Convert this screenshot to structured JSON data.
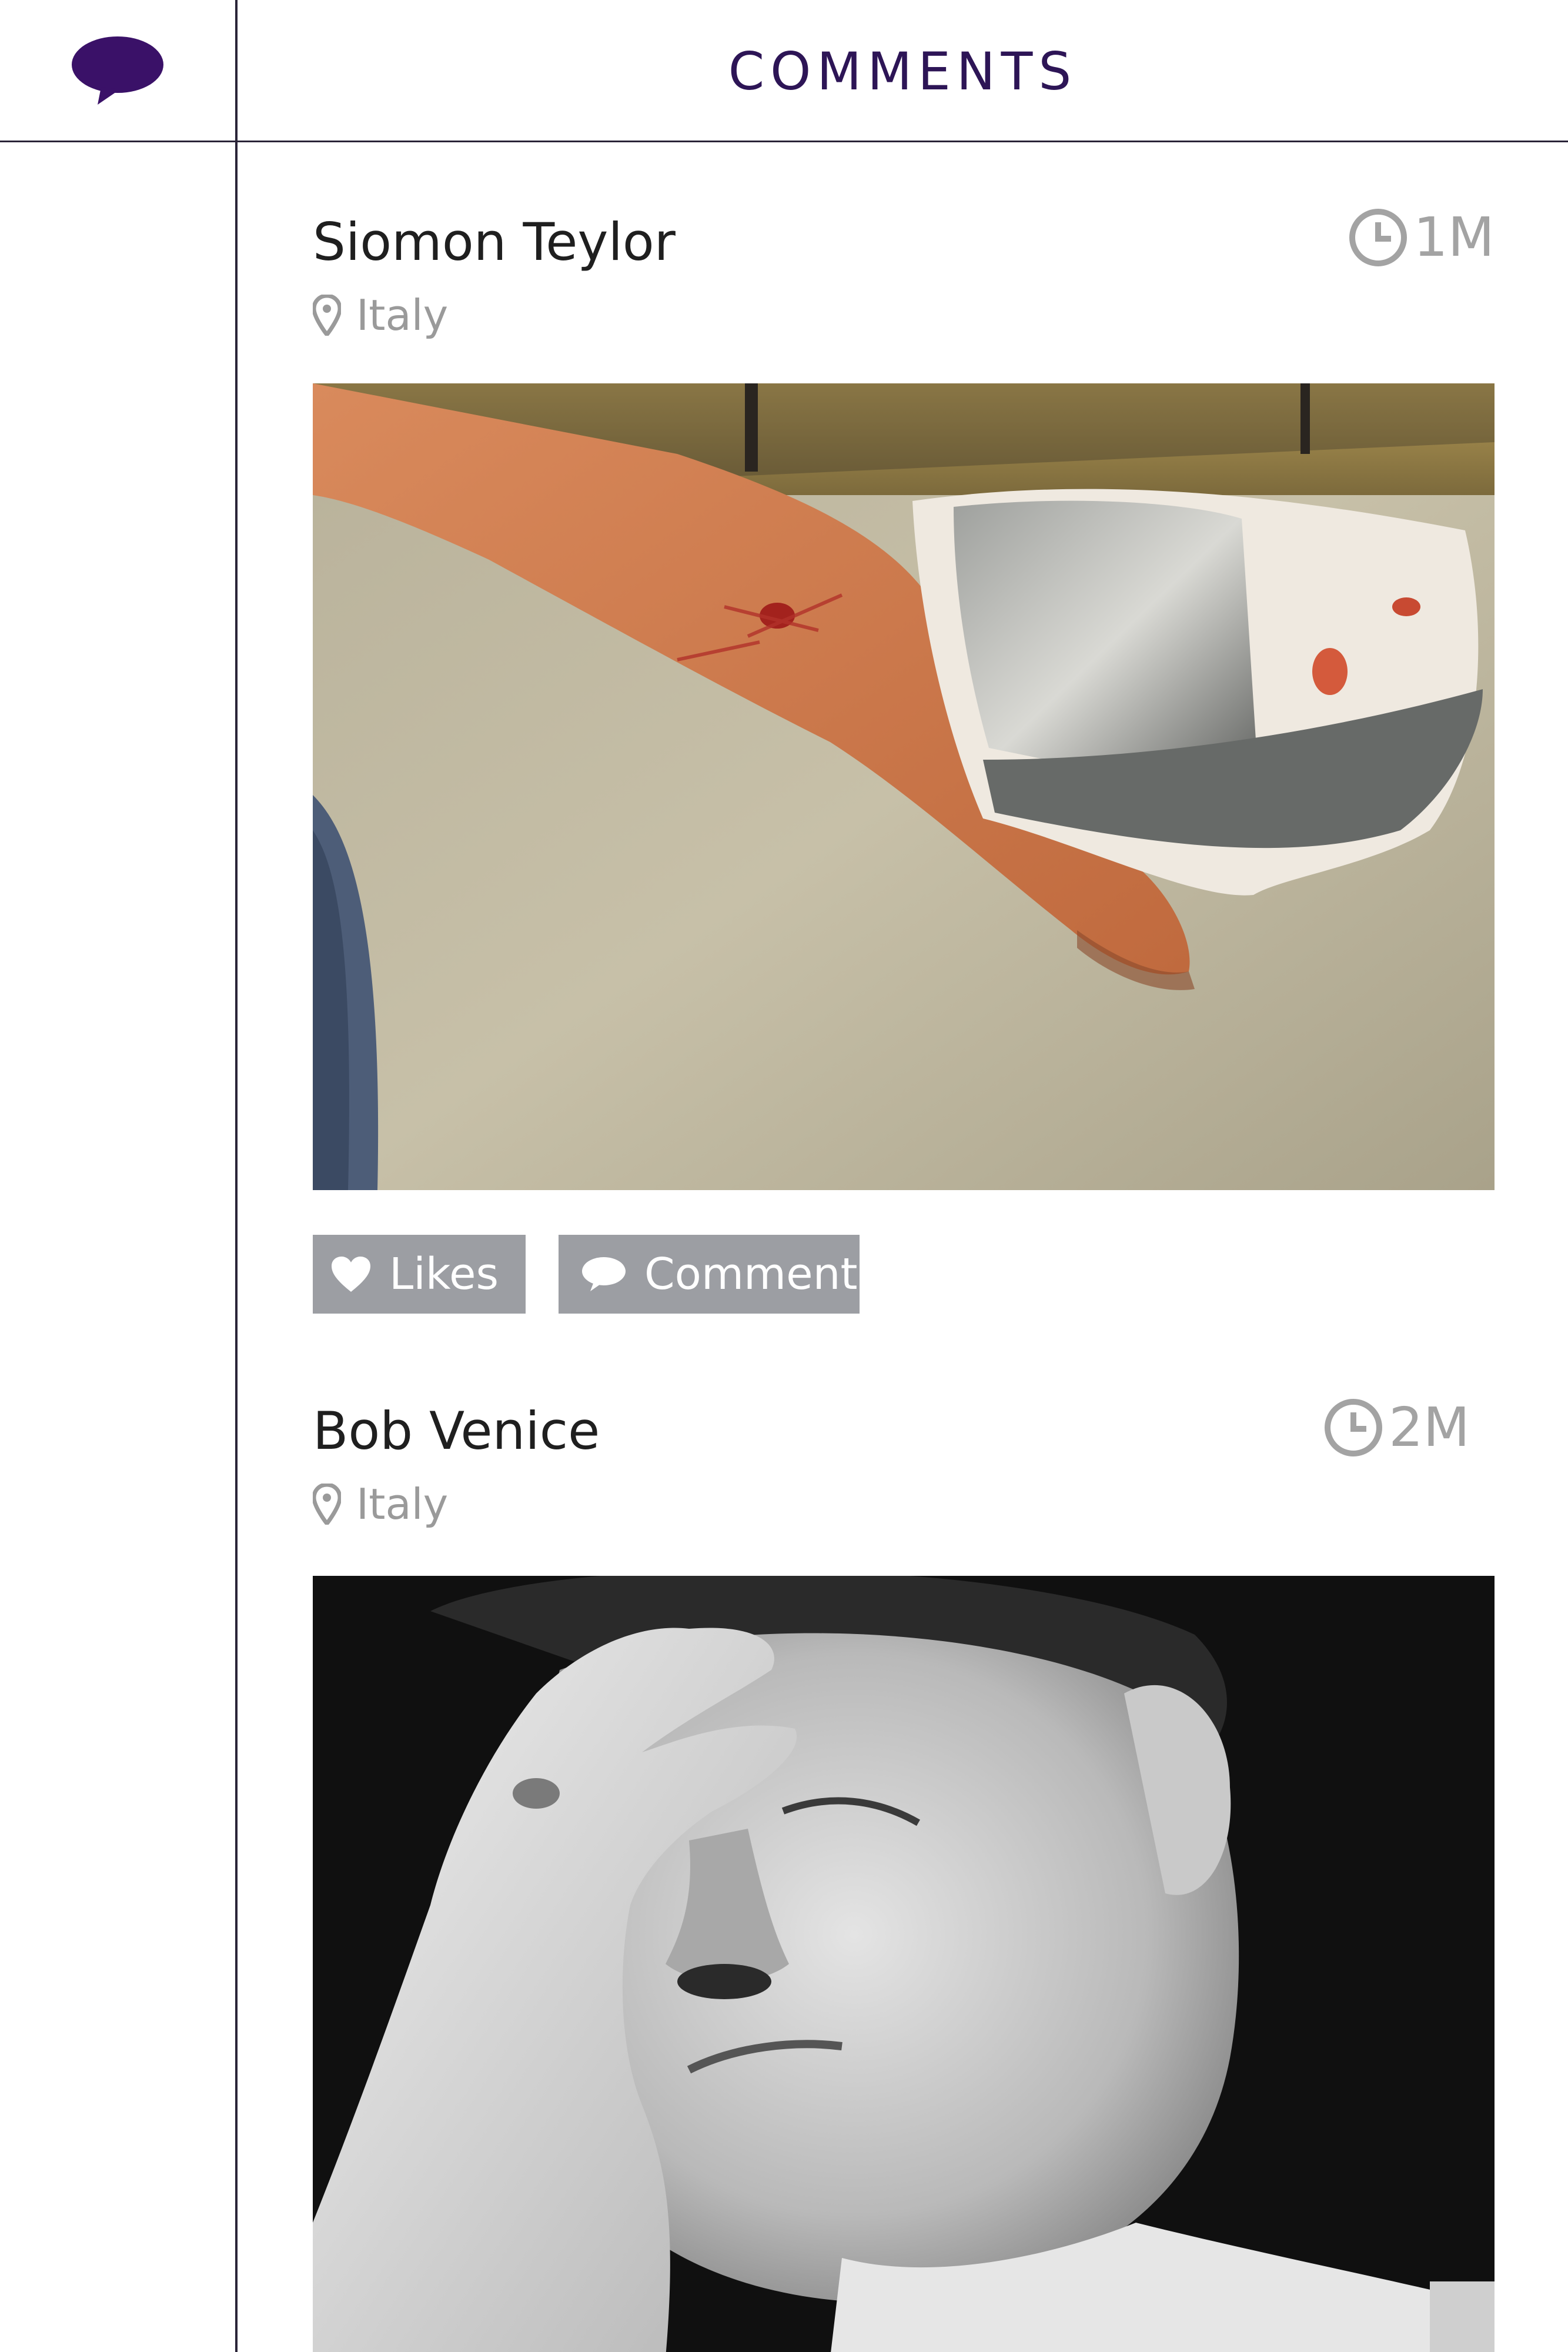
{
  "header": {
    "title": "COMMENTS",
    "icon": "speech-bubble-icon"
  },
  "colors": {
    "brand": "#3a1168",
    "title": "#2d1556",
    "divider": "#2a2438",
    "button_bg": "#9c9ea3",
    "muted_text": "#9a9a9a"
  },
  "posts": [
    {
      "author": "Siomon Teylor",
      "location": "Italy",
      "time": "1M",
      "image_subject": "bandaged-hand-photo",
      "likes_label": "Likes",
      "comment_label": "Comment"
    },
    {
      "author": "Bob Venice",
      "location": "Italy",
      "time": "2M",
      "image_subject": "tired-man-photo"
    }
  ]
}
